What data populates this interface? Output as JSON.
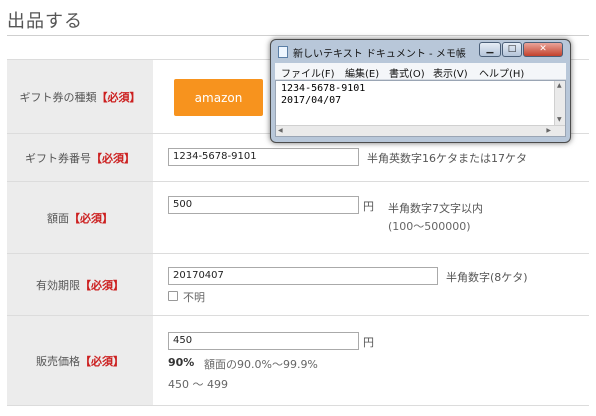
{
  "page": {
    "title": "出品する"
  },
  "form": {
    "required_mark": "【必須】",
    "gift_type": {
      "label": "ギフト券の種類",
      "button_label": "amazon"
    },
    "gift_number": {
      "label": "ギフト券番号",
      "value": "1234-5678-9101",
      "hint": "半角英数字16ケタまたは17ケタ"
    },
    "face_value": {
      "label": "額面",
      "value": "500",
      "unit": "円",
      "hint": "半角数字7文字以内",
      "hint_range": "(100〜500000)"
    },
    "expiry": {
      "label": "有効期限",
      "value": "20170407",
      "hint": "半角数字(8ケタ)",
      "unknown_label": "不明",
      "unknown_checked": false
    },
    "price": {
      "label": "販売価格",
      "value": "450",
      "unit": "円",
      "percent": "90%",
      "percent_note": "額面の90.0%〜99.9%",
      "range": "450 〜 499"
    }
  },
  "notepad": {
    "title": "新しいテキスト ドキュメント - メモ帳",
    "menu": [
      "ファイル(F)",
      "編集(E)",
      "書式(O)",
      "表示(V)",
      "ヘルプ(H)"
    ],
    "lines": [
      "1234-5678-9101",
      "2017/04/07"
    ],
    "minimize_glyph": "▁",
    "maximize_glyph": "□",
    "close_glyph": "✕"
  }
}
